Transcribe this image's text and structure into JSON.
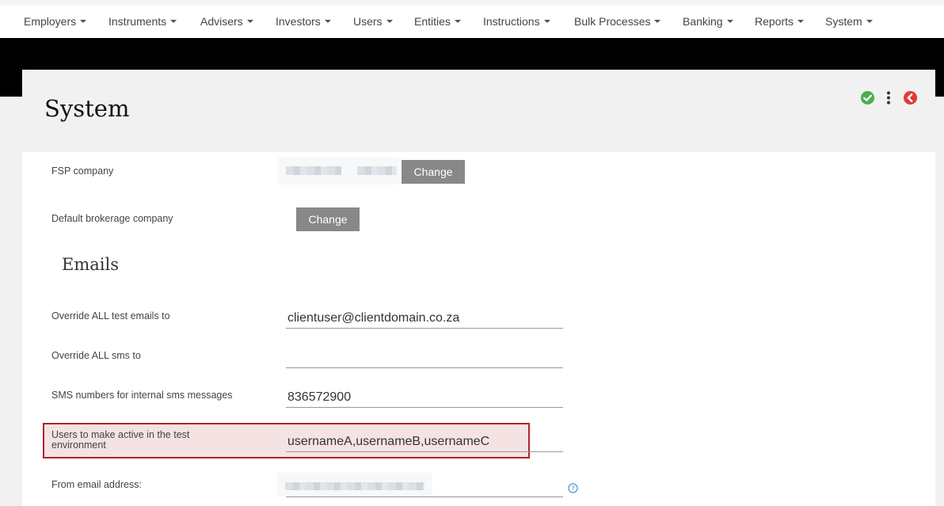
{
  "nav": {
    "items": [
      {
        "label": "Employers"
      },
      {
        "label": "Instruments"
      },
      {
        "label": "Advisers"
      },
      {
        "label": "Investors"
      },
      {
        "label": "Users"
      },
      {
        "label": "Entities"
      },
      {
        "label": "Instructions"
      },
      {
        "label": "Bulk Processes"
      },
      {
        "label": "Banking"
      },
      {
        "label": "Reports"
      },
      {
        "label": "System"
      }
    ]
  },
  "page": {
    "title": "System",
    "actions": {
      "save_icon": "check-circle-icon",
      "menu_icon": "vertical-ellipsis-icon",
      "back_icon": "chevron-left-circle-icon"
    }
  },
  "colors": {
    "success": "#4caf50",
    "danger": "#e53935",
    "button_gray": "#888888",
    "highlight_border": "#b1232b",
    "highlight_fill": "#f5e3e3"
  },
  "form": {
    "fsp_company": {
      "label": "FSP company",
      "change_label": "Change"
    },
    "default_brokerage": {
      "label": "Default brokerage company",
      "change_label": "Change"
    },
    "emails_section_title": "Emails",
    "override_emails": {
      "label": "Override ALL test emails to",
      "value": "clientuser@clientdomain.co.za"
    },
    "override_sms": {
      "label": "Override ALL sms to",
      "value": ""
    },
    "sms_numbers": {
      "label": "SMS numbers for internal sms messages",
      "value": "836572900"
    },
    "active_users": {
      "label": "Users to make active in the test environment",
      "value": "usernameA,usernameB,usernameC"
    },
    "from_email": {
      "label": "From email address:",
      "help_icon": "question-circle-icon"
    }
  }
}
